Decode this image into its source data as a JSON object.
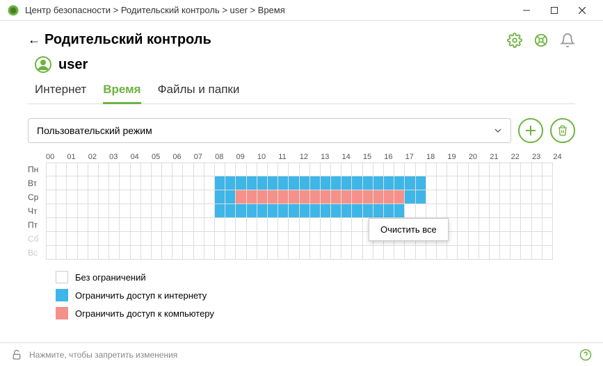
{
  "titlebar": {
    "breadcrumb": "Центр безопасности > Родительский контроль > user > Время"
  },
  "header": {
    "title": "Родительский контроль"
  },
  "user": {
    "name": "user"
  },
  "tabs": {
    "internet": "Интернет",
    "time": "Время",
    "files": "Файлы и папки"
  },
  "mode": {
    "selected": "Пользовательский режим"
  },
  "schedule": {
    "hours": [
      "00",
      "01",
      "02",
      "03",
      "04",
      "05",
      "06",
      "07",
      "08",
      "09",
      "10",
      "11",
      "12",
      "13",
      "14",
      "15",
      "16",
      "17",
      "18",
      "19",
      "20",
      "21",
      "22",
      "23",
      "24"
    ],
    "days": [
      "Пн",
      "Вт",
      "Ср",
      "Чт",
      "Пт",
      "Сб",
      "Вс"
    ]
  },
  "context_menu": {
    "clear_all": "Очистить все"
  },
  "legend": {
    "none": "Без ограничений",
    "internet": "Ограничить доступ к интернету",
    "computer": "Ограничить доступ к компьютеру"
  },
  "footer": {
    "hint": "Нажмите, чтобы запретить изменения"
  },
  "chart_data": {
    "type": "heatmap",
    "title": "",
    "xlabel": "hour",
    "ylabel": "day",
    "x_categories": [
      "00",
      "01",
      "02",
      "03",
      "04",
      "05",
      "06",
      "07",
      "08",
      "09",
      "10",
      "11",
      "12",
      "13",
      "14",
      "15",
      "16",
      "17",
      "18",
      "19",
      "20",
      "21",
      "22",
      "23"
    ],
    "y_categories": [
      "Пн",
      "Вт",
      "Ср",
      "Чт",
      "Пт",
      "Сб",
      "Вс"
    ],
    "legend": {
      "none": "Без ограничений",
      "internet": "Ограничить доступ к интернету",
      "computer": "Ограничить доступ к компьютеру"
    },
    "grid": [
      [
        "none",
        "none",
        "none",
        "none",
        "none",
        "none",
        "none",
        "none",
        "none",
        "none",
        "none",
        "none",
        "none",
        "none",
        "none",
        "none",
        "none",
        "none",
        "none",
        "none",
        "none",
        "none",
        "none",
        "none"
      ],
      [
        "none",
        "none",
        "none",
        "none",
        "none",
        "none",
        "none",
        "none",
        "internet",
        "internet",
        "internet",
        "internet",
        "internet",
        "internet",
        "internet",
        "internet",
        "internet",
        "internet",
        "none",
        "none",
        "none",
        "none",
        "none",
        "none"
      ],
      [
        "none",
        "none",
        "none",
        "none",
        "none",
        "none",
        "none",
        "none",
        "internet",
        "computer",
        "computer",
        "computer",
        "computer",
        "computer",
        "computer",
        "computer",
        "computer",
        "internet",
        "none",
        "none",
        "none",
        "none",
        "none",
        "none"
      ],
      [
        "none",
        "none",
        "none",
        "none",
        "none",
        "none",
        "none",
        "none",
        "internet",
        "internet",
        "internet",
        "internet",
        "internet",
        "internet",
        "internet",
        "internet",
        "internet",
        "none",
        "none",
        "none",
        "none",
        "none",
        "none",
        "none"
      ],
      [
        "none",
        "none",
        "none",
        "none",
        "none",
        "none",
        "none",
        "none",
        "none",
        "none",
        "none",
        "none",
        "none",
        "none",
        "none",
        "none",
        "none",
        "none",
        "none",
        "none",
        "none",
        "none",
        "none",
        "none"
      ],
      [
        "none",
        "none",
        "none",
        "none",
        "none",
        "none",
        "none",
        "none",
        "none",
        "none",
        "none",
        "none",
        "none",
        "none",
        "none",
        "none",
        "none",
        "none",
        "none",
        "none",
        "none",
        "none",
        "none",
        "none"
      ],
      [
        "none",
        "none",
        "none",
        "none",
        "none",
        "none",
        "none",
        "none",
        "none",
        "none",
        "none",
        "none",
        "none",
        "none",
        "none",
        "none",
        "none",
        "none",
        "none",
        "none",
        "none",
        "none",
        "none",
        "none"
      ]
    ]
  }
}
